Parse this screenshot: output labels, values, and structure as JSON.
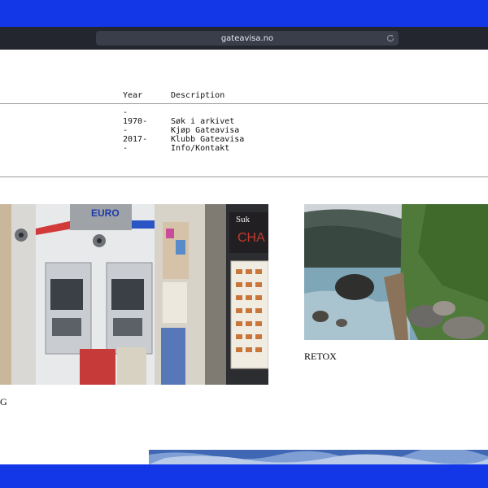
{
  "browser": {
    "url": "gateavisa.no",
    "reload_icon": "reload-icon"
  },
  "table": {
    "headers": {
      "year": "Year",
      "description": "Description"
    },
    "years_text": "-\n1970-\n-\n2017-\n-",
    "rows": [
      {
        "description": "Søk i arkivet"
      },
      {
        "description": "Kjøp Gateavisa"
      },
      {
        "description": "Klubb Gateavisa"
      },
      {
        "description": "Info/Kontakt"
      }
    ]
  },
  "gallery": {
    "items": [
      {
        "caption": "G",
        "euro_sign": "EURO",
        "shop_sign_1": "Suk",
        "shop_sign_2": "CHA"
      },
      {
        "caption": "RETOX"
      }
    ]
  },
  "colors": {
    "background_band": "#1336e6",
    "chrome": "#23252f",
    "url_bar": "#3a3d4a",
    "page": "#ffffff",
    "rule": "#9a9a9a"
  }
}
